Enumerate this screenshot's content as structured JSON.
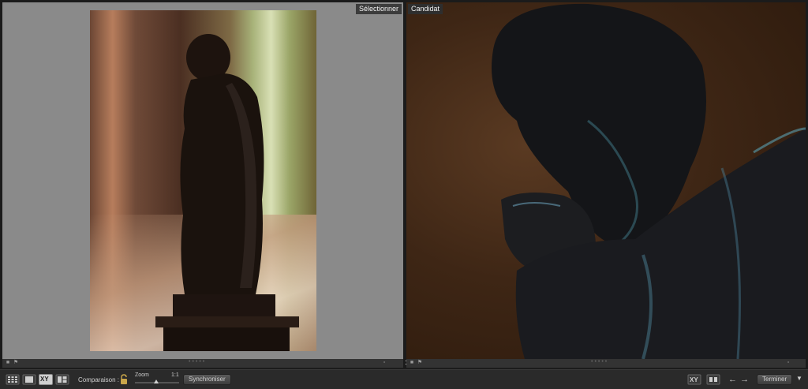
{
  "panels": {
    "left_label": "Sélectionner",
    "right_label": "Candidat"
  },
  "toolbar": {
    "compare_label": "Comparaison :",
    "zoom_label": "Zoom",
    "zoom_ratio": "1:1",
    "sync_label": "Synchroniser",
    "finish_label": "Terminer",
    "xy_label": "XY"
  },
  "icons": {
    "grid": "grid-view-icon",
    "loupe": "loupe-view-icon",
    "compare": "compare-view-icon",
    "survey": "survey-view-icon",
    "lock": "lock-icon",
    "swap": "swap-icon",
    "make_select": "make-select-icon",
    "prev": "previous-arrow-icon",
    "next": "next-arrow-icon"
  },
  "colors": {
    "background": "#1b1b1b",
    "left_panel_bg": "#8a8a8a"
  }
}
